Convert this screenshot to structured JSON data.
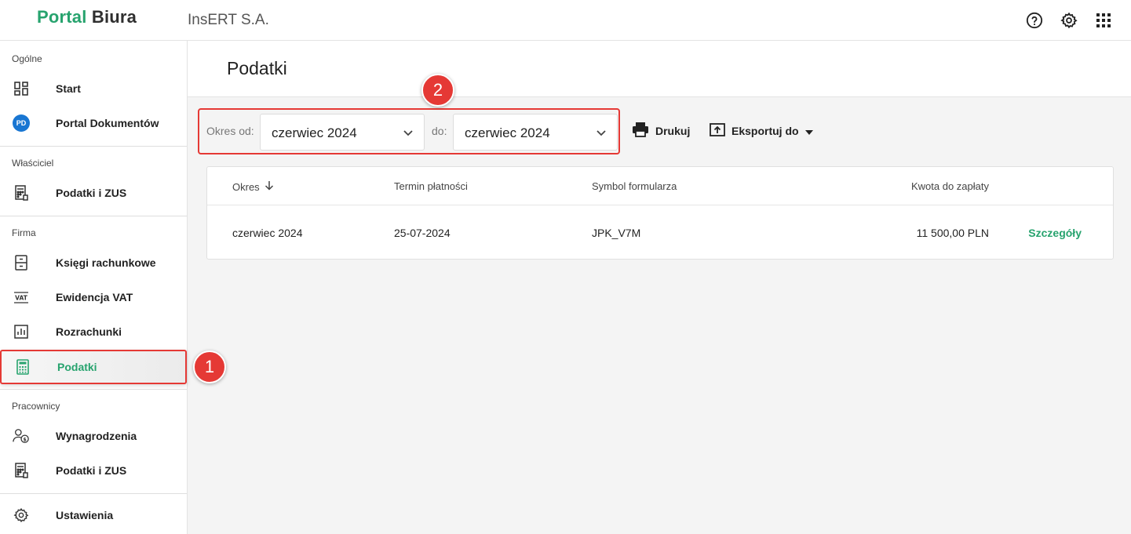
{
  "header": {
    "logo_part1": "Portal",
    "logo_part2": "Biura",
    "company": "InsERT S.A."
  },
  "sidebar": {
    "sections": [
      "Ogólne",
      "Właściciel",
      "Firma",
      "Pracownicy"
    ],
    "items": [
      {
        "label": "Start",
        "icon": "dashboard-icon"
      },
      {
        "label": "Portal Dokumentów",
        "icon": "pd-badge-icon",
        "badge": "PD"
      },
      {
        "label": "Podatki i ZUS",
        "icon": "calculator-icon"
      },
      {
        "label": "Księgi rachunkowe",
        "icon": "ledger-icon"
      },
      {
        "label": "Ewidencja VAT",
        "icon": "vat-icon",
        "badge": "VAT"
      },
      {
        "label": "Rozrachunki",
        "icon": "bar-chart-icon"
      },
      {
        "label": "Podatki",
        "icon": "calculator-icon",
        "active": true
      },
      {
        "label": "Wynagrodzenia",
        "icon": "salary-icon"
      },
      {
        "label": "Podatki i ZUS",
        "icon": "calculator-p-icon"
      },
      {
        "label": "Ustawienia",
        "icon": "gear-icon"
      }
    ]
  },
  "page": {
    "title": "Podatki"
  },
  "filters": {
    "from_label": "Okres od:",
    "from_value": "czerwiec 2024",
    "to_label": "do:",
    "to_value": "czerwiec 2024"
  },
  "toolbar": {
    "print_label": "Drukuj",
    "export_label": "Eksportuj do"
  },
  "table": {
    "columns": [
      "Okres",
      "Termin płatności",
      "Symbol formularza",
      "Kwota do zapłaty"
    ],
    "rows": [
      {
        "okres": "czerwiec 2024",
        "termin": "25-07-2024",
        "symbol": "JPK_V7M",
        "kwota": "11 500,00 PLN",
        "action": "Szczegóły"
      }
    ]
  },
  "callouts": [
    "1",
    "2"
  ],
  "colors": {
    "brand_green": "#27a36e",
    "highlight_red": "#e53935"
  }
}
